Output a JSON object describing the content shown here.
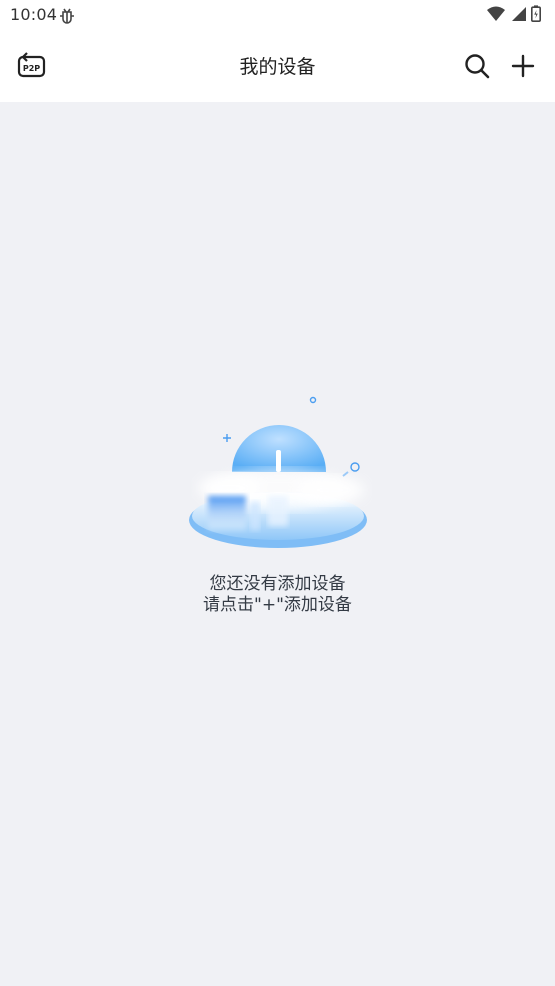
{
  "status_bar": {
    "time": "10:04",
    "icons": [
      "bug-icon",
      "wifi-icon",
      "signal-icon",
      "battery-icon"
    ]
  },
  "header": {
    "title": "我的设备",
    "p2p_badge": "P2P",
    "icons": [
      "p2p-icon",
      "search-icon",
      "plus-icon"
    ]
  },
  "empty_state": {
    "line1": "您还没有添加设备",
    "line2": "请点击\"+\"添加设备"
  },
  "colors": {
    "accent": "#4aa3f0",
    "background": "#f0f1f5",
    "header_bg": "#ffffff"
  }
}
